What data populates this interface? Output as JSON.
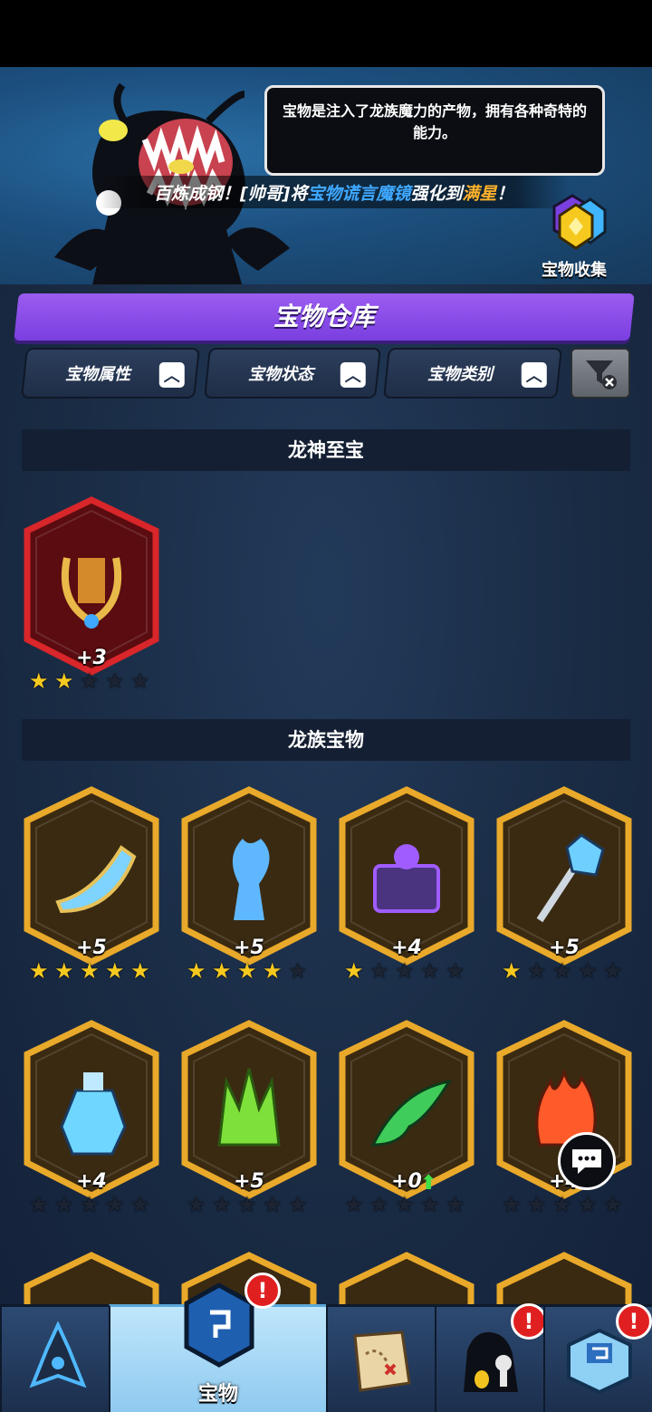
{
  "hero": {
    "speech": "宝物是注入了龙族魔力的产物，拥有各种奇特的能力。",
    "ticker": {
      "part1": "百炼成钢！[帅哥]将",
      "item": "宝物谎言魔镜",
      "part2": "强化到",
      "level": "满星",
      "end": "！"
    },
    "collect_label": "宝物收集"
  },
  "warehouse": {
    "title": "宝物仓库",
    "filters": [
      "宝物属性",
      "宝物状态",
      "宝物类别"
    ]
  },
  "sections": [
    {
      "title": "龙神至宝",
      "cards": [
        {
          "name": "golden-lyre",
          "plus": "+3",
          "stars": 2,
          "frame": "red",
          "icon": "lyre-icon",
          "accent": "#e9b949"
        }
      ]
    },
    {
      "title": "龙族宝物",
      "cards": [
        {
          "name": "frost-horn",
          "plus": "+5",
          "stars": 5,
          "frame": "gold",
          "icon": "horn-icon",
          "accent": "#7fd3ff"
        },
        {
          "name": "ice-dragon-statue",
          "plus": "+5",
          "stars": 4,
          "frame": "gold",
          "icon": "statue-icon",
          "accent": "#5fb8ff"
        },
        {
          "name": "shadow-chest",
          "plus": "+4",
          "stars": 1,
          "frame": "gold",
          "icon": "chest-icon",
          "accent": "#a05cff"
        },
        {
          "name": "frost-scepter",
          "plus": "+5",
          "stars": 1,
          "frame": "gold",
          "icon": "scepter-icon",
          "accent": "#6fd0ff"
        },
        {
          "name": "ice-potion",
          "plus": "+4",
          "stars": 0,
          "frame": "gold",
          "icon": "potion-icon",
          "accent": "#6fd6ff"
        },
        {
          "name": "jade-crown",
          "plus": "+5",
          "stars": 0,
          "frame": "gold",
          "icon": "crown-icon",
          "accent": "#7ee03a"
        },
        {
          "name": "emerald-wing",
          "plus": "+0",
          "stars": 0,
          "frame": "gold",
          "icon": "wing-icon",
          "accent": "#3fcc5a",
          "upgradable": true
        },
        {
          "name": "flame-claw",
          "plus": "+4",
          "stars": 0,
          "frame": "gold",
          "icon": "flame-icon",
          "accent": "#ff5a2a"
        }
      ]
    }
  ],
  "nav": {
    "items": [
      {
        "name": "crystal-tab",
        "label": "",
        "icon": "crystal-icon"
      },
      {
        "name": "treasure-tab",
        "label": "宝物",
        "icon": "treasure-rune-icon",
        "badge": "!"
      },
      {
        "name": "map-tab",
        "label": "",
        "icon": "map-icon"
      },
      {
        "name": "characters-tab",
        "label": "",
        "icon": "ghost-icon",
        "badge": "!"
      },
      {
        "name": "shop-tab",
        "label": "",
        "icon": "shop-icon",
        "badge": "!"
      }
    ]
  }
}
